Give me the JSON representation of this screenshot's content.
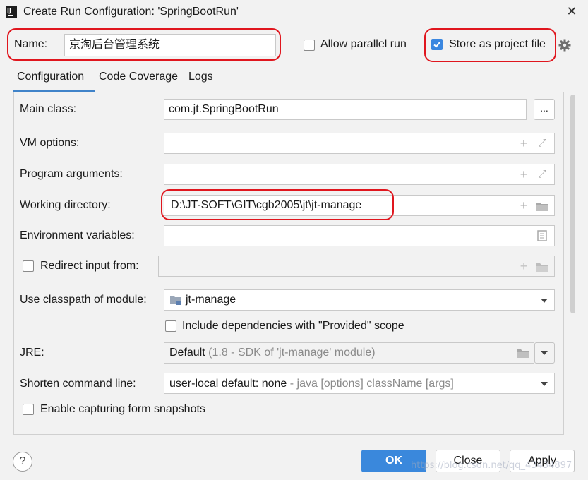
{
  "window": {
    "title": "Create Run Configuration: 'SpringBootRun'",
    "app_icon": "intellij-icon",
    "app_icon_text": "IJ"
  },
  "header": {
    "name_label": "Name:",
    "name_value": "京淘后台管理系统",
    "allow_parallel_label": "Allow parallel run",
    "allow_parallel_checked": false,
    "store_as_project_label": "Store as project file",
    "store_as_project_checked": true
  },
  "tabs": [
    {
      "label": "Configuration",
      "active": true
    },
    {
      "label": "Code Coverage",
      "active": false
    },
    {
      "label": "Logs",
      "active": false
    }
  ],
  "form": {
    "main_class": {
      "label": "Main class:",
      "value": "com.jt.SpringBootRun",
      "browse": "..."
    },
    "vm_options": {
      "label": "VM options:",
      "value": ""
    },
    "program_arguments": {
      "label": "Program arguments:",
      "value": ""
    },
    "working_directory": {
      "label": "Working directory:",
      "value": "D:\\JT-SOFT\\GIT\\cgb2005\\jt\\jt-manage"
    },
    "environment_variables": {
      "label": "Environment variables:",
      "value": ""
    },
    "redirect_input": {
      "label": "Redirect input from:",
      "checked": false,
      "value": ""
    },
    "classpath_module": {
      "label": "Use classpath of module:",
      "value": "jt-manage"
    },
    "include_provided": {
      "label": "Include dependencies with \"Provided\" scope",
      "checked": false
    },
    "jre": {
      "label": "JRE:",
      "value": "Default",
      "hint": "(1.8 - SDK of 'jt-manage' module)"
    },
    "shorten_cmd": {
      "label": "Shorten command line:",
      "value": "user-local default: none",
      "hint": "- java [options] className [args]"
    },
    "capture_snapshots": {
      "label": "Enable capturing form snapshots",
      "checked": false
    }
  },
  "footer": {
    "help": "?",
    "ok": "OK",
    "close": "Close",
    "apply": "Apply"
  },
  "watermark": "https://blog.csdn.net/qq_43434897",
  "colors": {
    "accent": "#3a88dc",
    "highlight": "#e0161e",
    "background": "#f2f2f2"
  }
}
